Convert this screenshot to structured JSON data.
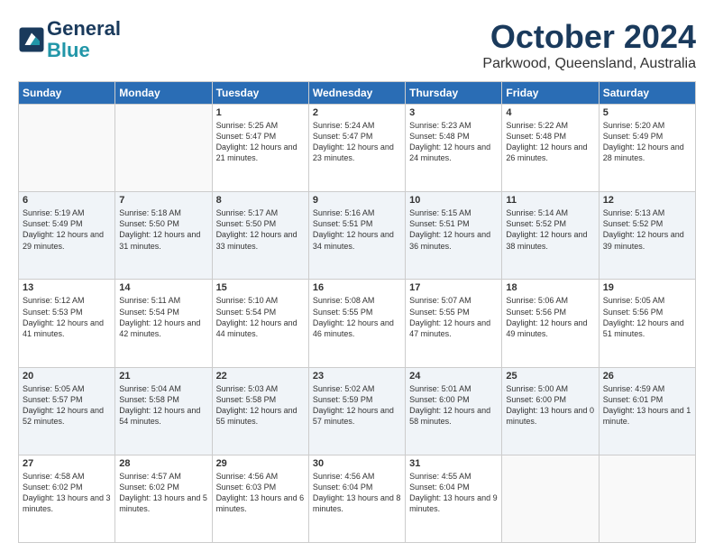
{
  "header": {
    "logo": {
      "line1": "General",
      "line2": "Blue"
    },
    "month": "October 2024",
    "location": "Parkwood, Queensland, Australia"
  },
  "weekdays": [
    "Sunday",
    "Monday",
    "Tuesday",
    "Wednesday",
    "Thursday",
    "Friday",
    "Saturday"
  ],
  "weeks": [
    [
      {
        "day": "",
        "sunrise": "",
        "sunset": "",
        "daylight": ""
      },
      {
        "day": "",
        "sunrise": "",
        "sunset": "",
        "daylight": ""
      },
      {
        "day": "1",
        "sunrise": "Sunrise: 5:25 AM",
        "sunset": "Sunset: 5:47 PM",
        "daylight": "Daylight: 12 hours and 21 minutes."
      },
      {
        "day": "2",
        "sunrise": "Sunrise: 5:24 AM",
        "sunset": "Sunset: 5:47 PM",
        "daylight": "Daylight: 12 hours and 23 minutes."
      },
      {
        "day": "3",
        "sunrise": "Sunrise: 5:23 AM",
        "sunset": "Sunset: 5:48 PM",
        "daylight": "Daylight: 12 hours and 24 minutes."
      },
      {
        "day": "4",
        "sunrise": "Sunrise: 5:22 AM",
        "sunset": "Sunset: 5:48 PM",
        "daylight": "Daylight: 12 hours and 26 minutes."
      },
      {
        "day": "5",
        "sunrise": "Sunrise: 5:20 AM",
        "sunset": "Sunset: 5:49 PM",
        "daylight": "Daylight: 12 hours and 28 minutes."
      }
    ],
    [
      {
        "day": "6",
        "sunrise": "Sunrise: 5:19 AM",
        "sunset": "Sunset: 5:49 PM",
        "daylight": "Daylight: 12 hours and 29 minutes."
      },
      {
        "day": "7",
        "sunrise": "Sunrise: 5:18 AM",
        "sunset": "Sunset: 5:50 PM",
        "daylight": "Daylight: 12 hours and 31 minutes."
      },
      {
        "day": "8",
        "sunrise": "Sunrise: 5:17 AM",
        "sunset": "Sunset: 5:50 PM",
        "daylight": "Daylight: 12 hours and 33 minutes."
      },
      {
        "day": "9",
        "sunrise": "Sunrise: 5:16 AM",
        "sunset": "Sunset: 5:51 PM",
        "daylight": "Daylight: 12 hours and 34 minutes."
      },
      {
        "day": "10",
        "sunrise": "Sunrise: 5:15 AM",
        "sunset": "Sunset: 5:51 PM",
        "daylight": "Daylight: 12 hours and 36 minutes."
      },
      {
        "day": "11",
        "sunrise": "Sunrise: 5:14 AM",
        "sunset": "Sunset: 5:52 PM",
        "daylight": "Daylight: 12 hours and 38 minutes."
      },
      {
        "day": "12",
        "sunrise": "Sunrise: 5:13 AM",
        "sunset": "Sunset: 5:52 PM",
        "daylight": "Daylight: 12 hours and 39 minutes."
      }
    ],
    [
      {
        "day": "13",
        "sunrise": "Sunrise: 5:12 AM",
        "sunset": "Sunset: 5:53 PM",
        "daylight": "Daylight: 12 hours and 41 minutes."
      },
      {
        "day": "14",
        "sunrise": "Sunrise: 5:11 AM",
        "sunset": "Sunset: 5:54 PM",
        "daylight": "Daylight: 12 hours and 42 minutes."
      },
      {
        "day": "15",
        "sunrise": "Sunrise: 5:10 AM",
        "sunset": "Sunset: 5:54 PM",
        "daylight": "Daylight: 12 hours and 44 minutes."
      },
      {
        "day": "16",
        "sunrise": "Sunrise: 5:08 AM",
        "sunset": "Sunset: 5:55 PM",
        "daylight": "Daylight: 12 hours and 46 minutes."
      },
      {
        "day": "17",
        "sunrise": "Sunrise: 5:07 AM",
        "sunset": "Sunset: 5:55 PM",
        "daylight": "Daylight: 12 hours and 47 minutes."
      },
      {
        "day": "18",
        "sunrise": "Sunrise: 5:06 AM",
        "sunset": "Sunset: 5:56 PM",
        "daylight": "Daylight: 12 hours and 49 minutes."
      },
      {
        "day": "19",
        "sunrise": "Sunrise: 5:05 AM",
        "sunset": "Sunset: 5:56 PM",
        "daylight": "Daylight: 12 hours and 51 minutes."
      }
    ],
    [
      {
        "day": "20",
        "sunrise": "Sunrise: 5:05 AM",
        "sunset": "Sunset: 5:57 PM",
        "daylight": "Daylight: 12 hours and 52 minutes."
      },
      {
        "day": "21",
        "sunrise": "Sunrise: 5:04 AM",
        "sunset": "Sunset: 5:58 PM",
        "daylight": "Daylight: 12 hours and 54 minutes."
      },
      {
        "day": "22",
        "sunrise": "Sunrise: 5:03 AM",
        "sunset": "Sunset: 5:58 PM",
        "daylight": "Daylight: 12 hours and 55 minutes."
      },
      {
        "day": "23",
        "sunrise": "Sunrise: 5:02 AM",
        "sunset": "Sunset: 5:59 PM",
        "daylight": "Daylight: 12 hours and 57 minutes."
      },
      {
        "day": "24",
        "sunrise": "Sunrise: 5:01 AM",
        "sunset": "Sunset: 6:00 PM",
        "daylight": "Daylight: 12 hours and 58 minutes."
      },
      {
        "day": "25",
        "sunrise": "Sunrise: 5:00 AM",
        "sunset": "Sunset: 6:00 PM",
        "daylight": "Daylight: 13 hours and 0 minutes."
      },
      {
        "day": "26",
        "sunrise": "Sunrise: 4:59 AM",
        "sunset": "Sunset: 6:01 PM",
        "daylight": "Daylight: 13 hours and 1 minute."
      }
    ],
    [
      {
        "day": "27",
        "sunrise": "Sunrise: 4:58 AM",
        "sunset": "Sunset: 6:02 PM",
        "daylight": "Daylight: 13 hours and 3 minutes."
      },
      {
        "day": "28",
        "sunrise": "Sunrise: 4:57 AM",
        "sunset": "Sunset: 6:02 PM",
        "daylight": "Daylight: 13 hours and 5 minutes."
      },
      {
        "day": "29",
        "sunrise": "Sunrise: 4:56 AM",
        "sunset": "Sunset: 6:03 PM",
        "daylight": "Daylight: 13 hours and 6 minutes."
      },
      {
        "day": "30",
        "sunrise": "Sunrise: 4:56 AM",
        "sunset": "Sunset: 6:04 PM",
        "daylight": "Daylight: 13 hours and 8 minutes."
      },
      {
        "day": "31",
        "sunrise": "Sunrise: 4:55 AM",
        "sunset": "Sunset: 6:04 PM",
        "daylight": "Daylight: 13 hours and 9 minutes."
      },
      {
        "day": "",
        "sunrise": "",
        "sunset": "",
        "daylight": ""
      },
      {
        "day": "",
        "sunrise": "",
        "sunset": "",
        "daylight": ""
      }
    ]
  ]
}
